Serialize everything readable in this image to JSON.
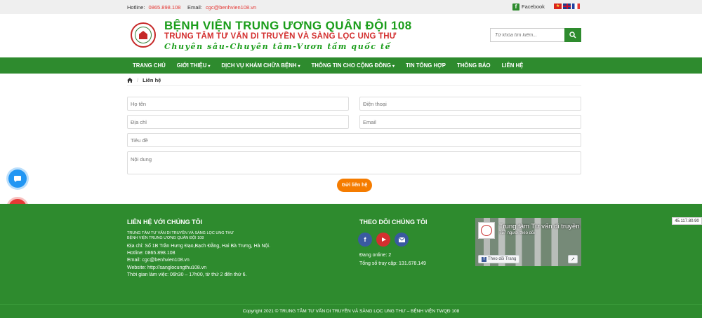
{
  "topbar": {
    "hotline_label": "Hotline:",
    "hotline_value": "0865.898.108",
    "email_label": "Email:",
    "email_value": "cgc@benhvien108.vn",
    "facebook_label": "Facebook"
  },
  "header": {
    "title": "BỆNH VIỆN TRUNG ƯƠNG QUÂN ĐỘI 108",
    "subtitle": "TRUNG TÂM TƯ VẤN DI TRUYỀN VÀ SÀNG LỌC UNG THƯ",
    "motto": "Chuyên sâu-Chuyên tâm-Vươn tầm quốc tế",
    "search_placeholder": "Từ khóa tìm kiếm..."
  },
  "nav": {
    "items": [
      {
        "label": "TRANG CHỦ",
        "dropdown": false
      },
      {
        "label": "GIỚI THIỆU",
        "dropdown": true
      },
      {
        "label": "DỊCH VỤ KHÁM CHỮA BỆNH",
        "dropdown": true
      },
      {
        "label": "THÔNG TIN CHO CỘNG ĐỒNG",
        "dropdown": true
      },
      {
        "label": "TIN TỔNG HỢP",
        "dropdown": false
      },
      {
        "label": "THÔNG BÁO",
        "dropdown": false
      },
      {
        "label": "LIÊN HỆ",
        "dropdown": false
      }
    ]
  },
  "breadcrumb": {
    "current": "Liên hệ"
  },
  "form": {
    "name_placeholder": "Họ tên",
    "phone_placeholder": "Điện thoại",
    "address_placeholder": "Địa chỉ",
    "email_placeholder": "Email",
    "subject_placeholder": "Tiêu đề",
    "content_placeholder": "Nội dung",
    "submit_label": "Gửi liên hệ"
  },
  "footer": {
    "contact_heading": "LIÊN HỆ VỚI CHÚNG TÔI",
    "org_line1": "TRUNG TÂM TƯ VẤN DI TRUYỀN VÀ SÀNG LỌC UNG THƯ",
    "org_line2": "BỆNH VIỆN TRUNG ƯƠNG QUÂN ĐỘI 108",
    "address": "Địa chỉ: Số 1B Trần Hưng Đạo,Bạch Đằng, Hai Bà Trưng, Hà Nội.",
    "hotline": "Hotline: 0865.898.108",
    "email": "Email: cgc@benhvien108.vn",
    "website": "Website: http://sanglocungthu108.vn",
    "hours": "Thời gian làm việc: 06h30 – 17h00, từ thứ 2 đến thứ 6.",
    "follow_heading": "THEO DÕI CHÚNG TÔI",
    "online": "Đang online: 2",
    "total_visits": "Tổng số truy cập: 131.678.149",
    "fb_page_name": "Trung tâm Tư vấn di truyền",
    "fb_followers": "757 người theo dõi",
    "fb_follow_label": "Theo dõi Trang",
    "ip_badge": "45.117.80.90",
    "copyright": "Copyright 2021 © TRUNG TÂM TƯ VẤN DI TRUYỀN VÀ SÀNG LỌC UNG THƯ – BỆNH VIỆN TWQĐ 108"
  },
  "colors": {
    "brand_green": "#2e8b2e",
    "accent_red": "#d32f2f",
    "submit_orange": "#f57c00"
  }
}
